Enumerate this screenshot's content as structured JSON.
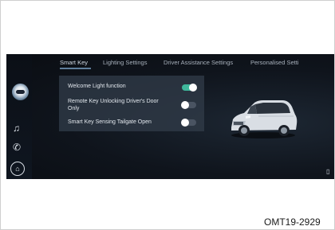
{
  "tabs": [
    {
      "label": "Smart Key",
      "active": true
    },
    {
      "label": "Lighting Settings",
      "active": false
    },
    {
      "label": "Driver Assistance Settings",
      "active": false
    },
    {
      "label": "Personalised Setti",
      "active": false
    }
  ],
  "settings": [
    {
      "label": "Welcome Light function",
      "enabled": true
    },
    {
      "label": "Remote Key Unlocking Driver's Door",
      "label_line2": "Only",
      "enabled": false
    },
    {
      "label": "Smart Key Sensing Tailgate Open",
      "enabled": false
    }
  ],
  "figure_code": "OMT19-2929",
  "colors": {
    "toggle_on": "#3fb89c",
    "toggle_off": "#4a5462",
    "accent_underline": "#5f7d9a"
  },
  "icons": {
    "sidebar": [
      "voice-assistant-icon",
      "music-icon",
      "phone-icon",
      "home-icon"
    ],
    "corner": "cup-holder-icon"
  }
}
